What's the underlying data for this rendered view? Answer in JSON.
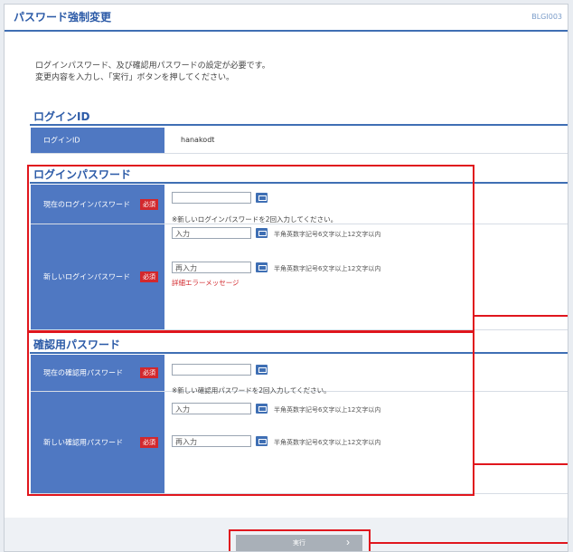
{
  "header": {
    "title": "パスワード強制変更",
    "screen_id": "BLGI003"
  },
  "intro": {
    "line1": "ログインパスワード、及び確認用パスワードの設定が必要です。",
    "line2": "変更内容を入力し、「実行」ボタンを押してください。"
  },
  "login_id": {
    "section_title": "ログインID",
    "label": "ログインID",
    "value": "hanakodt"
  },
  "login_password": {
    "section_title": "ログインパスワード",
    "current_label": "現在のログインパスワード",
    "new_label": "新しいログインパスワード",
    "note": "※新しいログインパスワードを2回入力してください。",
    "input_placeholder": "入力",
    "reinput_placeholder": "再入力",
    "hint": "半角英数字記号6文字以上12文字以内",
    "error": "詳細エラーメッセージ"
  },
  "confirm_password": {
    "section_title": "確認用パスワード",
    "current_label": "現在の確認用パスワード",
    "new_label": "新しい確認用パスワード",
    "note": "※新しい確認用パスワードを2回入力してください。",
    "input_placeholder": "入力",
    "reinput_placeholder": "再入力",
    "hint": "半角英数字記号6文字以上12文字以内"
  },
  "required_badge": "必須",
  "execute_label": "実行",
  "colors": {
    "accent": "#3f6fb4",
    "label_bg": "#4f78c2",
    "required": "#d2282d",
    "highlight": "#e0161d"
  }
}
